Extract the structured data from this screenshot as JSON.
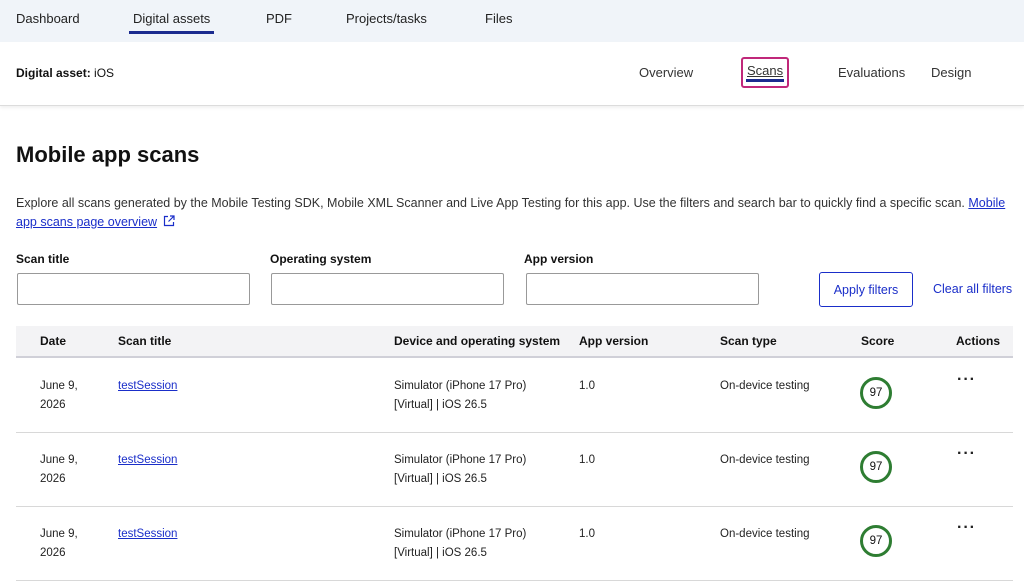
{
  "topnav": {
    "tabs": [
      {
        "label": "Dashboard"
      },
      {
        "label": "Digital assets"
      },
      {
        "label": "PDF"
      },
      {
        "label": "Projects/tasks"
      },
      {
        "label": "Files"
      }
    ],
    "active": "Digital assets"
  },
  "asset": {
    "label_prefix": "Digital asset:",
    "name": "iOS",
    "subtabs": [
      {
        "label": "Overview"
      },
      {
        "label": "Scans"
      },
      {
        "label": "Evaluations"
      },
      {
        "label": "Design"
      }
    ],
    "active_subtab": "Scans"
  },
  "page": {
    "title": "Mobile app scans",
    "description": "Explore all scans generated by the Mobile Testing SDK, Mobile XML Scanner and Live App Testing for this app. Use the filters and search bar to quickly find a specific scan.",
    "overview_link": "Mobile app scans page overview"
  },
  "filters": {
    "scan_title_label": "Scan title",
    "scan_title_value": "",
    "os_label": "Operating system",
    "os_value": "",
    "app_version_label": "App version",
    "app_version_value": "",
    "apply_label": "Apply filters",
    "clear_label": "Clear all filters"
  },
  "table": {
    "headers": {
      "date": "Date",
      "title": "Scan title",
      "device": "Device and operating system",
      "version": "App version",
      "type": "Scan type",
      "score": "Score",
      "actions": "Actions"
    },
    "rows": [
      {
        "date_1": "June 9,",
        "date_2": "2026",
        "title": "testSession",
        "device_1": "Simulator (iPhone 17 Pro)",
        "device_2": "[Virtual] | iOS 26.5",
        "version": "1.0",
        "type": "On-device testing",
        "score": "97",
        "actions": "···"
      },
      {
        "date_1": "June 9,",
        "date_2": "2026",
        "title": "testSession",
        "device_1": "Simulator (iPhone 17 Pro)",
        "device_2": "[Virtual] | iOS 26.5",
        "version": "1.0",
        "type": "On-device testing",
        "score": "97",
        "actions": "···"
      },
      {
        "date_1": "June 9,",
        "date_2": "2026",
        "title": "testSession",
        "device_1": "Simulator (iPhone 17 Pro)",
        "device_2": "[Virtual] | iOS 26.5",
        "version": "1.0",
        "type": "On-device testing",
        "score": "97",
        "actions": "···"
      }
    ]
  },
  "colors": {
    "link": "#1a2ec9",
    "active_tab_underline": "#1b2b8f",
    "focus_ring": "#c0287a",
    "score_ring": "#2e7d32",
    "topnav_bg": "#f0f4f9"
  },
  "icons": {
    "external_link": "external-link-icon",
    "actions": "more-horizontal-icon"
  }
}
